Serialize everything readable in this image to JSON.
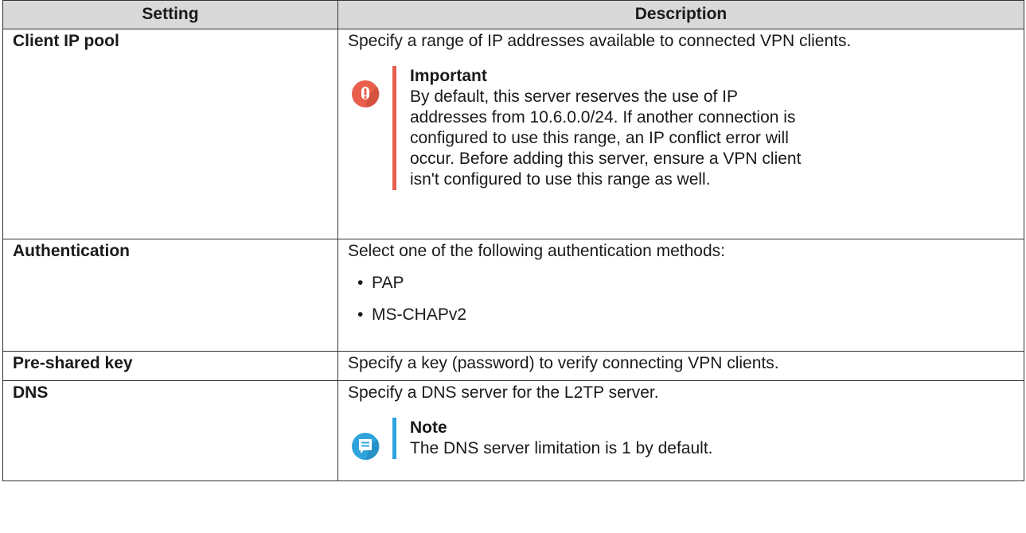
{
  "table": {
    "headers": {
      "setting": "Setting",
      "description": "Description"
    },
    "rows": {
      "client_ip_pool": {
        "setting": "Client IP pool",
        "description": "Specify a range of IP addresses available to connected VPN clients.",
        "callout": {
          "type": "important",
          "icon": "exclamation-icon",
          "color": "#e8604c",
          "title": "Important",
          "lines": [
            "By default, this server reserves the use of IP",
            "addresses from 10.6.0.0/24. If another connection is",
            "configured to use this range, an IP conflict error will",
            "occur. Before adding this server, ensure a VPN client",
            "isn't configured to use this range as well."
          ]
        }
      },
      "authentication": {
        "setting": "Authentication",
        "description": "Select one of the following authentication methods:",
        "bullet": "•",
        "methods": [
          "PAP",
          "MS-CHAPv2"
        ]
      },
      "pre_shared_key": {
        "setting": "Pre-shared key",
        "description": "Specify a key (password) to verify connecting VPN clients."
      },
      "dns": {
        "setting": "DNS",
        "description": "Specify a DNS server for the L2TP server.",
        "callout": {
          "type": "note",
          "icon": "note-icon",
          "color": "#2fa4dc",
          "title": "Note",
          "lines": [
            "The DNS server limitation is 1 by default."
          ]
        }
      }
    }
  }
}
